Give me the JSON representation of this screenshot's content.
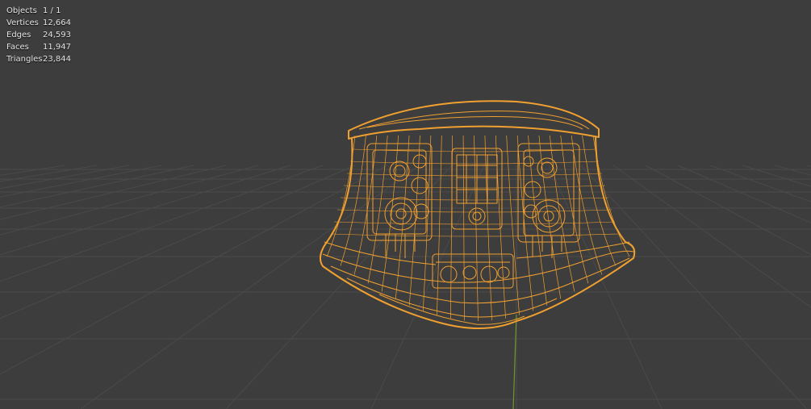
{
  "overlay": {
    "stats": [
      {
        "label": "Objects",
        "value": "1 / 1"
      },
      {
        "label": "Vertices",
        "value": "12,664"
      },
      {
        "label": "Edges",
        "value": "24,593"
      },
      {
        "label": "Faces",
        "value": "11,947"
      },
      {
        "label": "Triangles",
        "value": "23,844"
      }
    ]
  },
  "colors": {
    "background": "#3d3d3d",
    "grid_line": "#4a4a4a",
    "y_axis": "#6b9a2a",
    "wireframe": "#f0a030"
  }
}
